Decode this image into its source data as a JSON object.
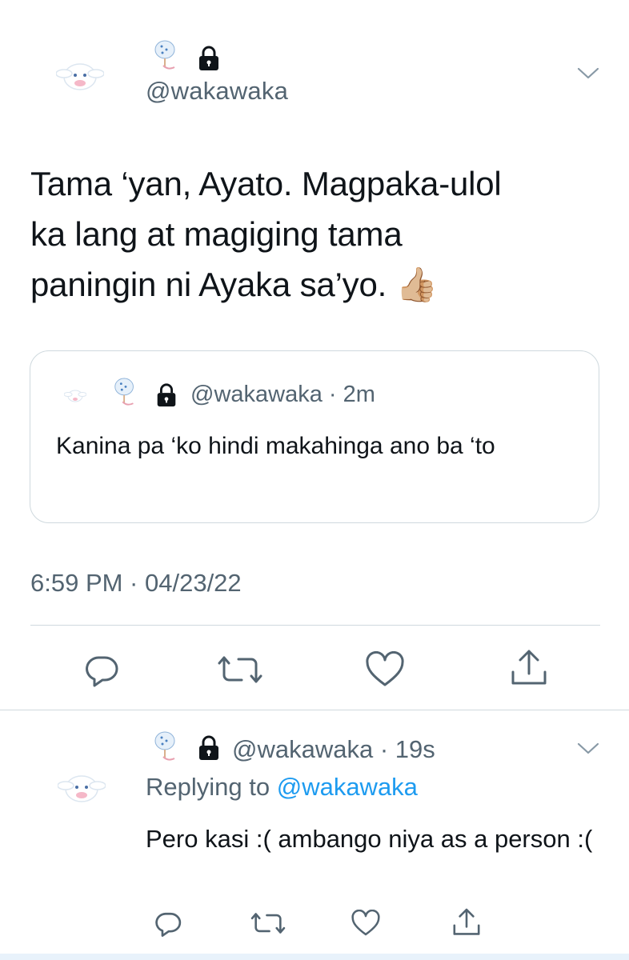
{
  "main_tweet": {
    "handle": "@wakawaka",
    "text_lines": [
      "Tama ‘yan, Ayato. Magpaka-ulol",
      "ka lang at magiging tama",
      "paningin ni Ayaka sa’yo."
    ],
    "thumbs_emoji": "👍🏼",
    "timestamp": "6:59 PM · 04/23/22"
  },
  "quoted_tweet": {
    "handle_time": "@wakawaka · 2m",
    "text": "Kanina pa ‘ko hindi makahinga ano ba ‘to"
  },
  "reply": {
    "handle_time": "@wakawaka · 19s",
    "replying_prefix": "Replying to ",
    "replying_to": "@wakawaka",
    "text": "Pero kasi :( ambango niya as a person :("
  },
  "icons": {
    "avatar": "cinnamoroll-avatar",
    "name_emoji": "ice-cream-emoji",
    "lock": "lock-icon",
    "chevron": "chevron-down-icon",
    "reply": "reply-icon",
    "retweet": "retweet-icon",
    "like": "heart-icon",
    "share": "share-icon"
  },
  "colors": {
    "text": "#0f1419",
    "secondary": "#536471",
    "link": "#1d9bf0",
    "border": "#cfd9de"
  }
}
